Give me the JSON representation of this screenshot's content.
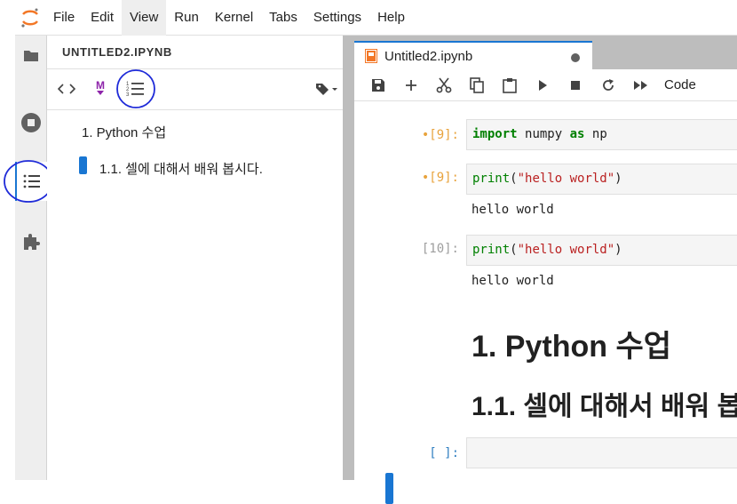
{
  "menu": {
    "items": [
      "File",
      "Edit",
      "View",
      "Run",
      "Kernel",
      "Tabs",
      "Settings",
      "Help"
    ],
    "active_index": 2
  },
  "activity_bar": {
    "icons": [
      "folder-icon",
      "running-icon",
      "toc-icon",
      "extension-icon"
    ],
    "selected": "toc-icon"
  },
  "toc_panel": {
    "title": "UNTITLED2.IPYNB",
    "entries": [
      {
        "label": "1. Python 수업",
        "level": 1,
        "active": false
      },
      {
        "label": "1.1. 셀에 대해서 배워 봅시다.",
        "level": 2,
        "active": true
      }
    ]
  },
  "notebook": {
    "tab_label": "Untitled2.ipynb",
    "cell_type": "Code",
    "cells": [
      {
        "prompt": "•[9]:",
        "state": "dirty",
        "code": [
          [
            "kw",
            "import"
          ],
          [
            "",
            "numpy "
          ],
          [
            "kw",
            "as"
          ],
          [
            "",
            "np"
          ]
        ]
      },
      {
        "prompt": "•[9]:",
        "state": "dirty",
        "code": [
          [
            "fn",
            "print"
          ],
          [
            "",
            "("
          ],
          [
            "str",
            "\"hello world\""
          ],
          [
            "",
            ")"
          ]
        ],
        "output": "hello world"
      },
      {
        "prompt": "[10]:",
        "state": "normal",
        "code": [
          [
            "fn",
            "print"
          ],
          [
            "",
            "("
          ],
          [
            "str",
            "\"hello world\""
          ],
          [
            "",
            ")"
          ]
        ],
        "output": "hello world"
      },
      {
        "prompt": "[ ]:",
        "state": "active"
      }
    ],
    "markdown": {
      "h1": "1. Python 수업",
      "h2": "1.1. 셀에 대해서 배워 봅"
    }
  },
  "colors": {
    "accent": "#1976d2",
    "dirty_prompt": "#e8a33d",
    "keyword": "#008000",
    "string": "#ba2121"
  }
}
